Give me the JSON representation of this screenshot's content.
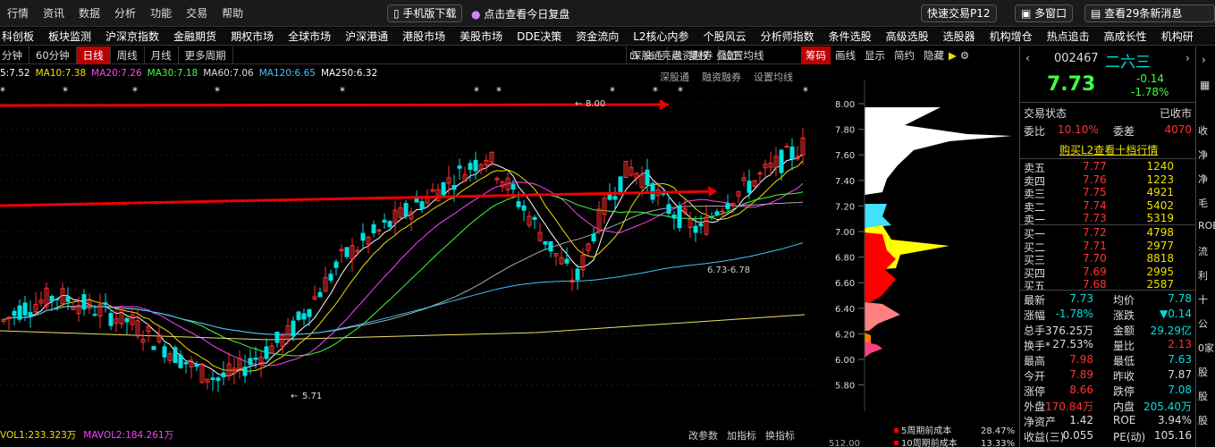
{
  "menu": {
    "items": [
      "行情",
      "资讯",
      "数据",
      "分析",
      "功能",
      "交易",
      "帮助"
    ],
    "mobile": "手机版下载",
    "replay": "点击查看今日复盘",
    "quicktrade": "快速交易P12",
    "multiwin": "多窗口",
    "news": "查看29条新消息"
  },
  "nav": {
    "items": [
      "科创板",
      "板块监测",
      "沪深京指数",
      "金融期货",
      "期权市场",
      "全球市场",
      "沪深港通",
      "港股市场",
      "美股市场",
      "DDE决策",
      "资金流向",
      "L2核心内参",
      "个股风云",
      "分析师指数",
      "条件选股",
      "高级选股",
      "选股器",
      "机构增仓",
      "热点追击",
      "高成长性",
      "机构研"
    ]
  },
  "tabs": {
    "items": [
      "分钟",
      "60分钟",
      "日线",
      "周线",
      "月线",
      "更多周期"
    ],
    "active": "日线"
  },
  "tools": {
    "items": [
      "深股通",
      "融资融券",
      "设置均线",
      "亮点",
      "复权",
      "叠加",
      "筹码",
      "画线",
      "显示",
      "简约",
      "隐藏"
    ]
  },
  "ma": {
    "ma5": "5:7.52",
    "ma10": "MA10:7.38",
    "ma20": "MA20:7.26",
    "ma30": "MA30:7.18",
    "ma60": "MA60:7.06",
    "ma120": "MA120:6.65",
    "ma250": "MA250:6.32"
  },
  "annot": {
    "high": "8.00",
    "low": "5.71",
    "range": "6.73-6.78"
  },
  "yaxis": [
    "8.00",
    "7.80",
    "7.60",
    "7.40",
    "7.20",
    "7.00",
    "6.80",
    "6.60",
    "6.40",
    "6.20",
    "6.00",
    "5.80"
  ],
  "chips": {
    "legend5": "5周期前成本",
    "legend5v": "28.47%",
    "legend10": "10周期前成本",
    "legend10v": "13.33%",
    "bottom": "512.00"
  },
  "volume": {
    "vol1": "VOL1:233.323万",
    "vol2": "MAVOL2:184.261万",
    "tools": [
      "改参数",
      "加指标",
      "换指标"
    ]
  },
  "quote": {
    "code": "002467",
    "name": "二六三",
    "price": "7.73",
    "change": "-0.14",
    "pct": "-1.78%",
    "status_l": "交易状态",
    "status_r": "已收市",
    "weibi_l": "委比",
    "weibi": "10.10%",
    "weicha_l": "委差",
    "weicha": "4070",
    "l2": "购买L2查看十档行情"
  },
  "asks": [
    {
      "l": "卖五",
      "p": "7.77",
      "v": "1240"
    },
    {
      "l": "卖四",
      "p": "7.76",
      "v": "1223"
    },
    {
      "l": "卖三",
      "p": "7.75",
      "v": "4921"
    },
    {
      "l": "卖二",
      "p": "7.74",
      "v": "5402"
    },
    {
      "l": "卖一",
      "p": "7.73",
      "v": "5319"
    }
  ],
  "bids": [
    {
      "l": "买一",
      "p": "7.72",
      "v": "4798"
    },
    {
      "l": "买二",
      "p": "7.71",
      "v": "2977"
    },
    {
      "l": "买三",
      "p": "7.70",
      "v": "8818"
    },
    {
      "l": "买四",
      "p": "7.69",
      "v": "2995"
    },
    {
      "l": "买五",
      "p": "7.68",
      "v": "2587"
    }
  ],
  "stats": [
    [
      "最新",
      "7.73",
      "均价",
      "7.78"
    ],
    [
      "涨幅",
      "-1.78%",
      "涨跌",
      "▼0.14"
    ],
    [
      "总手",
      "376.25万",
      "金额",
      "29.29亿"
    ],
    [
      "换手*",
      "27.53%",
      "量比",
      "2.13"
    ],
    [
      "最高",
      "7.98",
      "最低",
      "7.63"
    ],
    [
      "今开",
      "7.89",
      "昨收",
      "7.87"
    ],
    [
      "涨停",
      "8.66",
      "跌停",
      "7.08"
    ],
    [
      "外盘",
      "170.84万",
      "内盘",
      "205.40万"
    ],
    [
      "净资产",
      "1.42",
      "ROE",
      "3.94%"
    ],
    [
      "收益(三)",
      "0.055",
      "PE(动)",
      "105.16"
    ]
  ],
  "side": [
    "收",
    "净",
    "净",
    "毛",
    "ROE",
    "流",
    "利",
    "十",
    "公",
    "0家",
    "股",
    "股",
    "股"
  ]
}
